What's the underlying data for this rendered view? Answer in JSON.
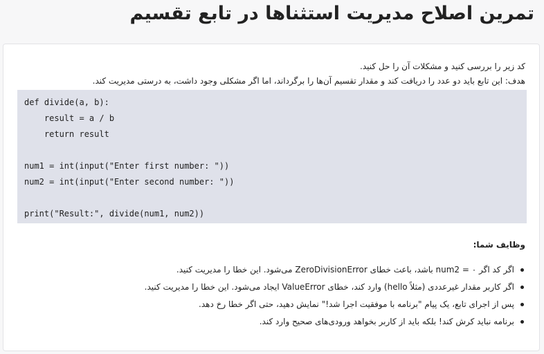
{
  "page": {
    "title": "تمرین اصلاح مدیریت استثناها در تابع تقسیم"
  },
  "intro": {
    "line1": "کد زیر را بررسی کنید و مشکلات آن را حل کنید.",
    "line2": "هدف: این تابع باید دو عدد را دریافت کند و مقدار تقسیم آن‌ها را برگرداند، اما اگر مشکلی وجود داشت، به درستی مدیریت کند."
  },
  "code": {
    "lines": [
      "def divide(a, b):",
      "    result = a / b",
      "    return result",
      "",
      "num1 = int(input(\"Enter first number: \"))",
      "num2 = int(input(\"Enter second number: \"))",
      "",
      "print(\"Result:\", divide(num1, num2))"
    ]
  },
  "tasks": {
    "heading": "وظایف شما:",
    "items": [
      "اگر کد اگر num2 = ۰ باشد، باعث خطای ZeroDivisionError می‌شود. این خطا را مدیریت کنید.",
      "اگر کاربر مقدار غیرعددی (مثلاً hello) وارد کند، خطای ValueError ایجاد می‌شود. این خطا را مدیریت کنید.",
      "پس از اجرای تابع، یک پیام \"برنامه با موفقیت اجرا شد!\" نمایش دهید، حتی اگر خطا رخ دهد.",
      "برنامه نباید کرش کند! بلکه باید از کاربر بخواهد ورودی‌های صحیح وارد کند."
    ]
  }
}
